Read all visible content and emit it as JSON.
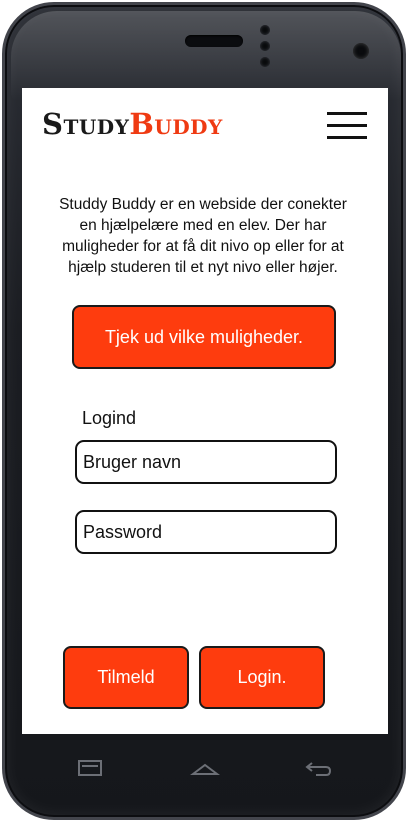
{
  "header": {
    "logo_part1": "Study",
    "logo_part2": "Buddy"
  },
  "intro_text": "Studdy Buddy er en webside der conekter en hjælpelære med en elev. Der har muligheder for at få dit nivo op eller for at hjælp studeren til et  nyt nivo eller højer.",
  "cta_label": "Tjek ud vilke muligheder.",
  "login": {
    "title": "Logind",
    "username_placeholder": "Bruger navn",
    "password_placeholder": "Password"
  },
  "buttons": {
    "signup": "Tilmeld",
    "login": "Login."
  },
  "colors": {
    "accent": "#fe3c0e",
    "phone_body": "#1b1d22"
  },
  "icons": [
    "menu-icon",
    "recent-apps-icon",
    "home-icon",
    "back-icon"
  ]
}
